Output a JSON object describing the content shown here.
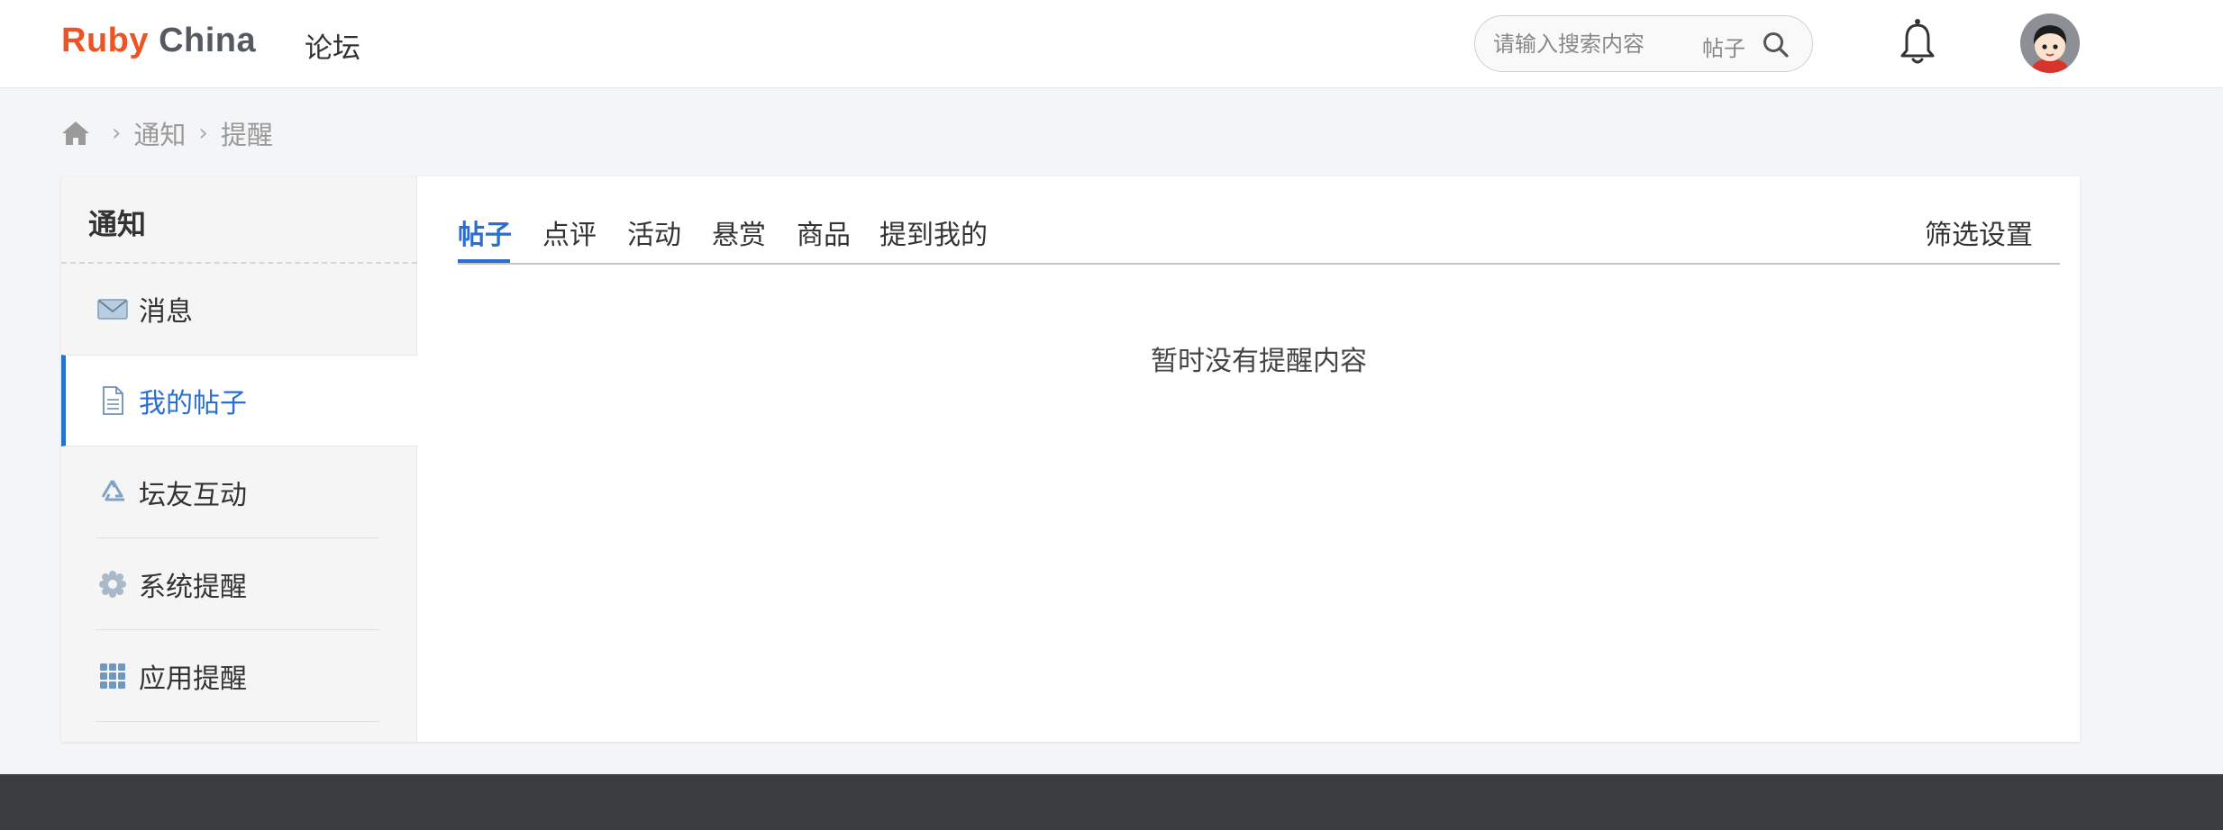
{
  "header": {
    "logo_ruby": "Ruby",
    "logo_china": "China",
    "nav_forum": "论坛",
    "search_placeholder": "请输入搜索内容",
    "search_scope": "帖子"
  },
  "breadcrumb": {
    "items": [
      "通知",
      "提醒"
    ]
  },
  "sidebar": {
    "title": "通知",
    "items": [
      {
        "label": "消息",
        "icon": "envelope-icon"
      },
      {
        "label": "我的帖子",
        "icon": "document-icon",
        "active": true
      },
      {
        "label": "坛友互动",
        "icon": "recycle-icon"
      },
      {
        "label": "系统提醒",
        "icon": "gear-icon"
      },
      {
        "label": "应用提醒",
        "icon": "grid-icon"
      }
    ]
  },
  "tabs": {
    "items": [
      "帖子",
      "点评",
      "活动",
      "悬赏",
      "商品",
      "提到我的"
    ],
    "active": "帖子",
    "filter_settings": "筛选设置"
  },
  "content": {
    "empty_message": "暂时没有提醒内容"
  },
  "colors": {
    "accent": "#2a6fd0",
    "logo_ruby": "#eb5424",
    "logo_china": "#555a60",
    "footer": "#3c3d41"
  }
}
